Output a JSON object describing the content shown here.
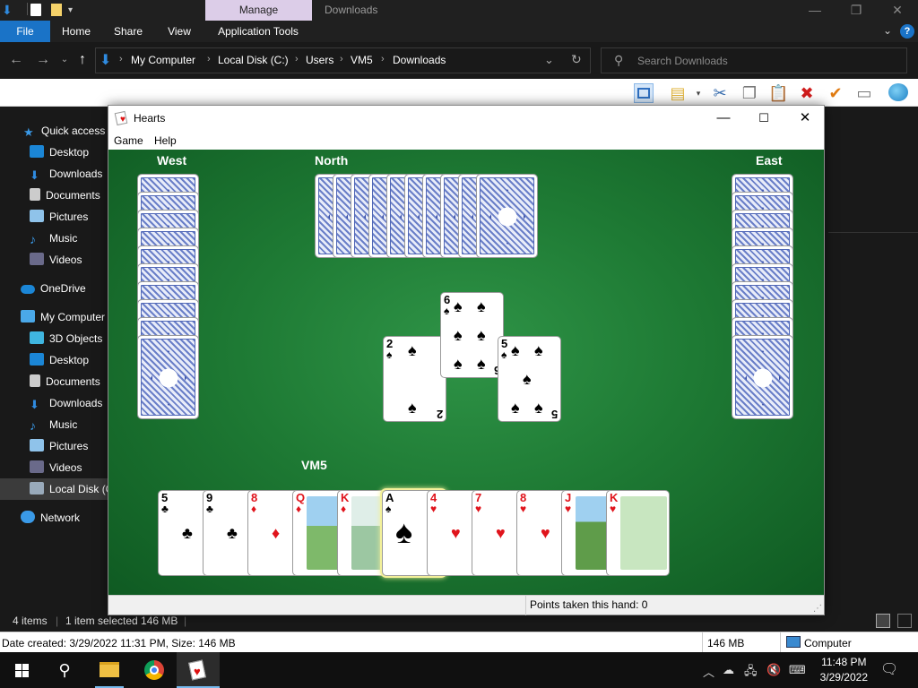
{
  "explorer": {
    "manage_tab": "Manage",
    "window_title": "Downloads",
    "ribbon_tabs": [
      "File",
      "Home",
      "Share",
      "View",
      "Application Tools"
    ],
    "breadcrumb": [
      "My Computer",
      "Local Disk (C:)",
      "Users",
      "VM5",
      "Downloads"
    ],
    "search_placeholder": "Search Downloads",
    "nav": {
      "quick_access": "Quick access",
      "quick_items": [
        "Desktop",
        "Downloads",
        "Documents",
        "Pictures",
        "Music",
        "Videos"
      ],
      "onedrive": "OneDrive",
      "my_computer": "My Computer",
      "computer_items": [
        "3D Objects",
        "Desktop",
        "Documents",
        "Downloads",
        "Music",
        "Pictures",
        "Videos",
        "Local Disk (C"
      ],
      "network": "Network"
    },
    "status": {
      "items": "4 items",
      "selected": "1 item selected  146 MB"
    },
    "details": {
      "info": "Date created: 3/29/2022 11:31 PM, Size: 146 MB",
      "size": "146 MB",
      "location": "Computer"
    }
  },
  "hearts": {
    "title": "Hearts",
    "menu": [
      "Game",
      "Help"
    ],
    "players": {
      "west": "West",
      "north": "North",
      "east": "East",
      "south": "VM5"
    },
    "trick": [
      {
        "rank": "2",
        "suit": "♠",
        "color": "black"
      },
      {
        "rank": "6",
        "suit": "♠",
        "color": "black"
      },
      {
        "rank": "5",
        "suit": "♠",
        "color": "black"
      }
    ],
    "hand": [
      {
        "rank": "5",
        "suit": "♣",
        "color": "black"
      },
      {
        "rank": "9",
        "suit": "♣",
        "color": "black"
      },
      {
        "rank": "8",
        "suit": "♦",
        "color": "red"
      },
      {
        "rank": "Q",
        "suit": "♦",
        "color": "red"
      },
      {
        "rank": "K",
        "suit": "♦",
        "color": "red"
      },
      {
        "rank": "A",
        "suit": "♠",
        "color": "black"
      },
      {
        "rank": "4",
        "suit": "♥",
        "color": "red"
      },
      {
        "rank": "7",
        "suit": "♥",
        "color": "red"
      },
      {
        "rank": "8",
        "suit": "♥",
        "color": "red"
      },
      {
        "rank": "J",
        "suit": "♥",
        "color": "red"
      },
      {
        "rank": "K",
        "suit": "♥",
        "color": "red"
      }
    ],
    "points_label": "Points taken this hand: 0"
  },
  "taskbar": {
    "time": "11:48 PM",
    "date": "3/29/2022"
  }
}
